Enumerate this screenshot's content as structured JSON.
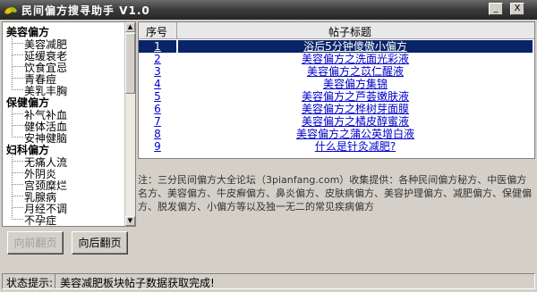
{
  "window": {
    "title": "民间偏方搜寻助手  V1.0",
    "min_symbol": "_",
    "close_symbol": "X"
  },
  "tree": {
    "categories": [
      {
        "label": "美容偏方",
        "items": [
          "美容减肥",
          "延缓衰老",
          "饮食宜忌",
          "青春痘",
          "美乳丰胸"
        ]
      },
      {
        "label": "保健偏方",
        "items": [
          "补气补血",
          "健体活血",
          "安神健脑"
        ]
      },
      {
        "label": "妇科偏方",
        "items": [
          "无痛人流",
          "外阴炎",
          "宫颈糜烂",
          "乳腺病",
          "月经不调",
          "不孕症"
        ]
      }
    ]
  },
  "grid": {
    "col_num": "序号",
    "col_title": "帖子标题",
    "rows": [
      {
        "num": "1",
        "title": "浴后5分钟傻傲小偏方"
      },
      {
        "num": "2",
        "title": "美容偏方之洗面光彩液"
      },
      {
        "num": "3",
        "title": "美容偏方之苡仁醒液"
      },
      {
        "num": "4",
        "title": "美容偏方集锦"
      },
      {
        "num": "5",
        "title": "美容偏方之芦荟嫩肤液"
      },
      {
        "num": "6",
        "title": "美容偏方之桦树芽面膜"
      },
      {
        "num": "7",
        "title": "美容偏方之橘皮醇蜜液"
      },
      {
        "num": "8",
        "title": "美容偏方之蒲公英增白液"
      },
      {
        "num": "9",
        "title": "什么是针灸减肥?"
      }
    ]
  },
  "notice": {
    "text": "注：三分民间偏方大全论坛（3pianfang.com）收集提供：各种民间偏方秘方、中医偏方名方、美容偏方、牛皮癣偏方、鼻炎偏方、皮肤病偏方、美容护理偏方、减肥偏方、保健偏方、脱发偏方、小偏方等以及独一无二的常见疾病偏方"
  },
  "buttons": {
    "prev": "向前翻页",
    "next": "向后翻页"
  },
  "status": {
    "label": "状态提示:",
    "message": "美容减肥板块帖子数据获取完成!"
  },
  "colors": {
    "titlebar": "#3a3a3a",
    "link": "#0000cc",
    "selection": "#0a246a"
  }
}
